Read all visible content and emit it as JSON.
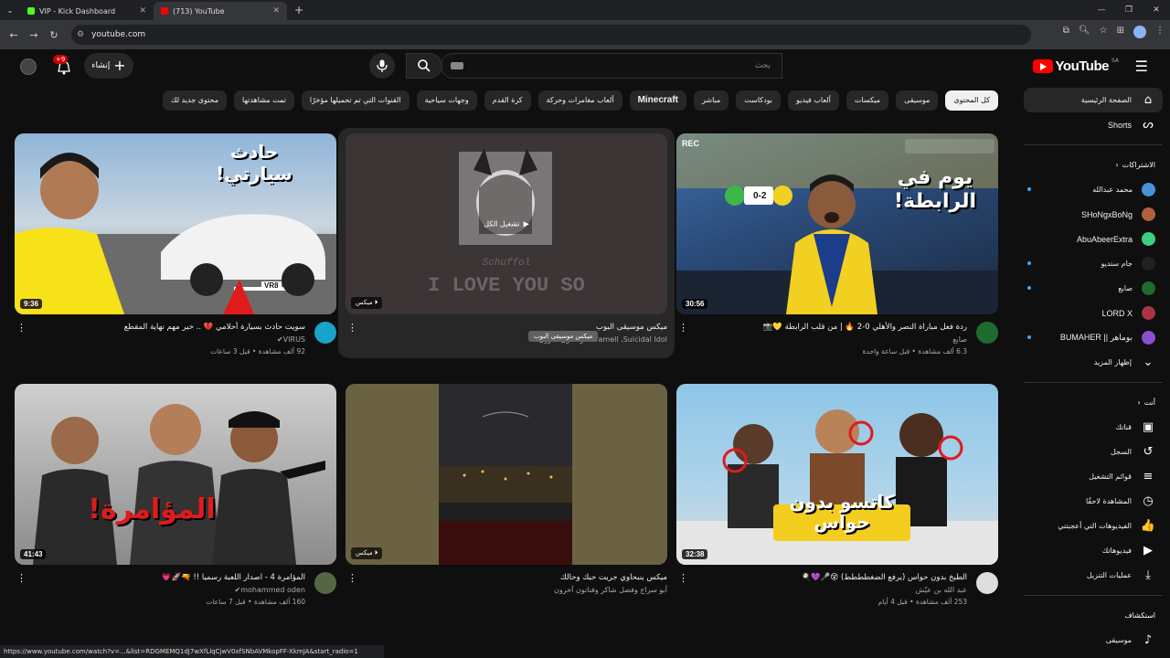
{
  "browser": {
    "tabs": [
      {
        "title": "VIP - Kick Dashboard",
        "active": false,
        "favicon_color": "#53fc18"
      },
      {
        "title": "(713) YouTube",
        "active": true,
        "favicon_color": "#ff0000"
      }
    ],
    "url": "youtube.com",
    "status_text": "https://www.youtube.com/watch?v=...&list=RDGMEMQ1dJ7wXfLlqCjwV0xfSNbAVMkopFF-XkmJA&start_radio=1"
  },
  "header": {
    "logo_text": "YouTube",
    "country_code": "SA",
    "search_placeholder": "بحث",
    "create_label": "إنشاء",
    "notification_count": "+9"
  },
  "chips": [
    {
      "label": "كل المحتوى",
      "active": true
    },
    {
      "label": "موسيقى"
    },
    {
      "label": "ميكسات"
    },
    {
      "label": "ألعاب فيديو"
    },
    {
      "label": "بودكاست"
    },
    {
      "label": "مباشر"
    },
    {
      "label": "Minecraft",
      "bold": true
    },
    {
      "label": "ألعاب مغامرات وحركة"
    },
    {
      "label": "كرة القدم"
    },
    {
      "label": "وجهات سياحية"
    },
    {
      "label": "القنوات التي تم تحميلها مؤخرًا"
    },
    {
      "label": "تمت مشاهدتها"
    },
    {
      "label": "محتوى جديد لك"
    }
  ],
  "sidebar": {
    "home": "الصفحة الرئيسية",
    "shorts": "Shorts",
    "subscriptions_header": "الاشتراكات",
    "subscriptions": [
      {
        "name": "محمد عبدالله",
        "latin": false,
        "live": true,
        "color": "#4a90d9"
      },
      {
        "name": "SHoNgxBoNg",
        "latin": true,
        "live": false,
        "color": "#b06040"
      },
      {
        "name": "AbuAbeerExtra",
        "latin": true,
        "live": false,
        "color": "#3ccf80"
      },
      {
        "name": "جام ستديو",
        "latin": false,
        "live": true,
        "color": "#222222"
      },
      {
        "name": "صايع",
        "latin": false,
        "live": true,
        "color": "#1f6b2d"
      },
      {
        "name": "LORD X",
        "latin": true,
        "live": false,
        "color": "#aa3344"
      },
      {
        "name": "بوماهر || BUMAHER",
        "latin": true,
        "live": true,
        "color": "#8a4fd0"
      }
    ],
    "show_more": "إظهار المزيد",
    "you_header": "أنت",
    "you_items": [
      {
        "label": "قناتك",
        "icon": "channel-icon",
        "glyph": "▣"
      },
      {
        "label": "السجل",
        "icon": "history-icon",
        "glyph": "↺"
      },
      {
        "label": "قوائم التشغيل",
        "icon": "playlists-icon",
        "glyph": "≡"
      },
      {
        "label": "المشاهدة لاحقًا",
        "icon": "watch-later-icon",
        "glyph": "◷"
      },
      {
        "label": "الفيديوهات التي أعجبتني",
        "icon": "like-icon",
        "glyph": "👍"
      },
      {
        "label": "فيديوهاتك",
        "icon": "your-videos-icon",
        "glyph": "▶"
      },
      {
        "label": "عمليات التنزيل",
        "icon": "download-icon",
        "glyph": "⤓"
      }
    ],
    "explore_header": "استكشاف",
    "explore_items": [
      {
        "label": "موسيقى",
        "icon": "music-icon",
        "glyph": "♪"
      }
    ]
  },
  "videos": [
    {
      "title": "ردة فعل مباراة النصر والأهلي 0-2 🔥 | من قلب الرابطة 💛📸",
      "channel": "صايع",
      "stats": "6.3 ألف مشاهدة • قبل ساعة واحدة",
      "duration": "30:56",
      "rec": "REC",
      "thumb_text": "يوم في الرابطة!",
      "score": "0-2",
      "avatar_color": "#1f6b2d"
    },
    {
      "title": "ميكس موسيقى البوب",
      "channel": "Caramell ،Suicidal Idol وفنانون آخرون",
      "stats": "",
      "mix": "ميكس",
      "play_all": "تشغيل الكل",
      "thumb_text": "I LOVE YOU SO",
      "thumb_sub": "Schuffol",
      "tooltip": "ميكس موسيقى البوب"
    },
    {
      "title": "سويت حادث بسيارة أحلامي 💔 .. خبر مهم نهاية المقطع",
      "channel": "VIRUS✔",
      "stats": "92 ألف مشاهدة • قبل 3 ساعات",
      "duration": "9:36",
      "thumb_text": "حادث سيارتي!",
      "plate": "VR8",
      "avatar_color": "#1aa3c8"
    },
    {
      "title": "الطبخ بدون حواس (يرفع الضغطططط) 😵🎤💜🍳",
      "channel": "عبد الله بن عيّش",
      "stats": "253 ألف مشاهدة • قبل 4 أيام",
      "duration": "32:38",
      "thumb_text": "كاتسو بدون حواس",
      "avatar_color": "#dddddd"
    },
    {
      "title": "ميكس ينبحاوي جريت حبك وحالك",
      "channel": "أبو سراج وفضل شاكر وفنانون آخرون",
      "stats": "",
      "mix": "ميكس"
    },
    {
      "title": "المؤامرة 4 - اصدار اللعبة رسميا !! 🔫🚀💗",
      "channel": "mohammed oden✔",
      "stats": "160 ألف مشاهدة • قبل 7 ساعات",
      "duration": "41:43",
      "thumb_text": "المؤامرة!",
      "avatar_color": "#556644"
    }
  ],
  "colors": {
    "background": "#0f0f0f",
    "brand_red": "#ff0000",
    "chip_bg": "#272727",
    "accent_blue": "#3ea6ff"
  }
}
